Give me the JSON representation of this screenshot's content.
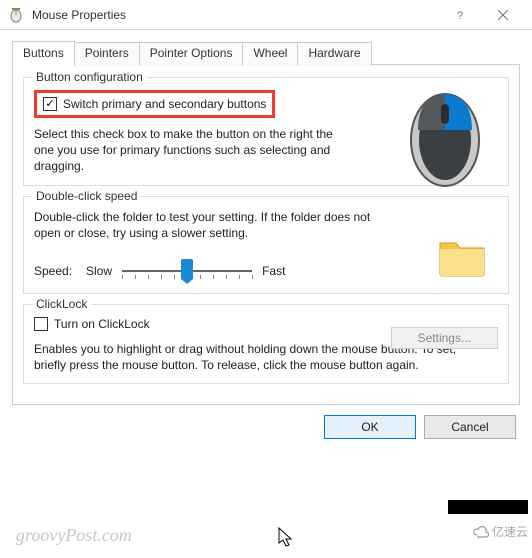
{
  "window": {
    "title": "Mouse Properties"
  },
  "tabs": [
    "Buttons",
    "Pointers",
    "Pointer Options",
    "Wheel",
    "Hardware"
  ],
  "btncfg": {
    "legend": "Button configuration",
    "switch_label": "Switch primary and secondary buttons",
    "switch_checked": true,
    "desc": "Select this check box to make the button on the right the one you use for primary functions such as selecting and dragging."
  },
  "dblclick": {
    "legend": "Double-click speed",
    "desc": "Double-click the folder to test your setting. If the folder does not open or close, try using a slower setting.",
    "speed_label": "Speed:",
    "slow": "Slow",
    "fast": "Fast"
  },
  "clicklock": {
    "legend": "ClickLock",
    "turn_on_label": "Turn on ClickLock",
    "turn_on_checked": false,
    "settings_label": "Settings...",
    "desc": "Enables you to highlight or drag without holding down the mouse button. To set, briefly press the mouse button. To release, click the mouse button again."
  },
  "buttons": {
    "ok": "OK",
    "cancel": "Cancel"
  },
  "watermark": "groovyPost.com",
  "watermark2": "亿速云"
}
